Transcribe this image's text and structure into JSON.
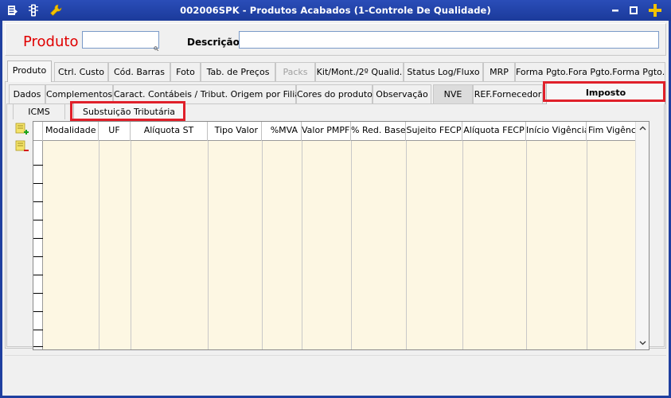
{
  "window": {
    "title": "002006SPK - Produtos Acabados (1-Controle De Qualidade)",
    "title_color": "#1f3fa0"
  },
  "header": {
    "produto_label": "Produto",
    "produto_value": "",
    "descricao_label": "Descrição",
    "descricao_value": ""
  },
  "main_tabs": [
    {
      "label": "Produto",
      "state": "active"
    },
    {
      "label": "Ctrl. Custo",
      "state": "normal"
    },
    {
      "label": "Cód. Barras",
      "state": "normal"
    },
    {
      "label": "Foto",
      "state": "normal"
    },
    {
      "label": "Tab. de Preços",
      "state": "normal"
    },
    {
      "label": "Packs",
      "state": "disabled"
    },
    {
      "label": "Kit/Mont./2º Qualid.",
      "state": "normal"
    },
    {
      "label": "Status Log/Fluxo",
      "state": "normal"
    },
    {
      "label": "MRP",
      "state": "normal"
    },
    {
      "label": "Forma Pgto.Fora Pgto.Forma Pgto.",
      "state": "normal"
    }
  ],
  "sub_tabs": [
    {
      "label": "Dados",
      "state": "normal"
    },
    {
      "label": "Complementos",
      "state": "normal"
    },
    {
      "label": "Caract. Contábeis / Tribut. Origem por Filiais",
      "state": "normal"
    },
    {
      "label": "Cores do produto",
      "state": "normal"
    },
    {
      "label": "Observação",
      "state": "normal"
    },
    {
      "label": "NVE",
      "state": "normal"
    },
    {
      "label": "REF.Fornecedor",
      "state": "normal"
    },
    {
      "label": "Imposto",
      "state": "active"
    }
  ],
  "tax_tabs": [
    {
      "label": "ICMS",
      "state": "normal"
    },
    {
      "label": "Substuição Tributária",
      "state": "active"
    }
  ],
  "grid": {
    "columns": [
      "Modalidade",
      "UF",
      "Alíquota ST",
      "Tipo Valor",
      "%MVA",
      "Valor PMPF",
      "% Red. Base",
      "Sujeito FECP",
      "Alíquota FECP",
      "Início Vigência",
      "Fim Vigência"
    ],
    "rows": []
  },
  "colors": {
    "highlight": "#e0202a",
    "grid_body": "#fdf7e3",
    "produto_label": "#e00000"
  }
}
